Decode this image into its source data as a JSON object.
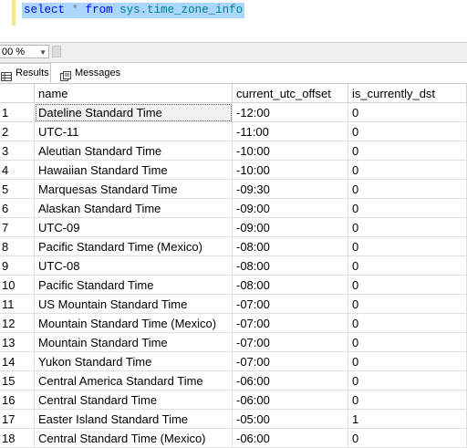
{
  "editor": {
    "query": {
      "kw1": "select",
      "star": "*",
      "kw2": "from",
      "table": "sys.time_zone_info"
    }
  },
  "zoom": {
    "value": "00 %"
  },
  "tabs": {
    "results": "Results",
    "messages": "Messages"
  },
  "grid": {
    "columns": [
      "",
      "name",
      "current_utc_offset",
      "is_currently_dst"
    ],
    "rows": [
      [
        "1",
        "Dateline Standard Time",
        "-12:00",
        "0"
      ],
      [
        "2",
        "UTC-11",
        "-11:00",
        "0"
      ],
      [
        "3",
        "Aleutian Standard Time",
        "-10:00",
        "0"
      ],
      [
        "4",
        "Hawaiian Standard Time",
        "-10:00",
        "0"
      ],
      [
        "5",
        "Marquesas Standard Time",
        "-09:30",
        "0"
      ],
      [
        "6",
        "Alaskan Standard Time",
        "-09:00",
        "0"
      ],
      [
        "7",
        "UTC-09",
        "-09:00",
        "0"
      ],
      [
        "8",
        "Pacific Standard Time (Mexico)",
        "-08:00",
        "0"
      ],
      [
        "9",
        "UTC-08",
        "-08:00",
        "0"
      ],
      [
        "10",
        "Pacific Standard Time",
        "-08:00",
        "0"
      ],
      [
        "11",
        "US Mountain Standard Time",
        "-07:00",
        "0"
      ],
      [
        "12",
        "Mountain Standard Time (Mexico)",
        "-07:00",
        "0"
      ],
      [
        "13",
        "Mountain Standard Time",
        "-07:00",
        "0"
      ],
      [
        "14",
        "Yukon Standard Time",
        "-07:00",
        "0"
      ],
      [
        "15",
        "Central America Standard Time",
        "-06:00",
        "0"
      ],
      [
        "16",
        "Central Standard Time",
        "-06:00",
        "0"
      ],
      [
        "17",
        "Easter Island Standard Time",
        "-05:00",
        "1"
      ],
      [
        "18",
        "Central Standard Time (Mexico)",
        "-06:00",
        "0"
      ]
    ]
  }
}
